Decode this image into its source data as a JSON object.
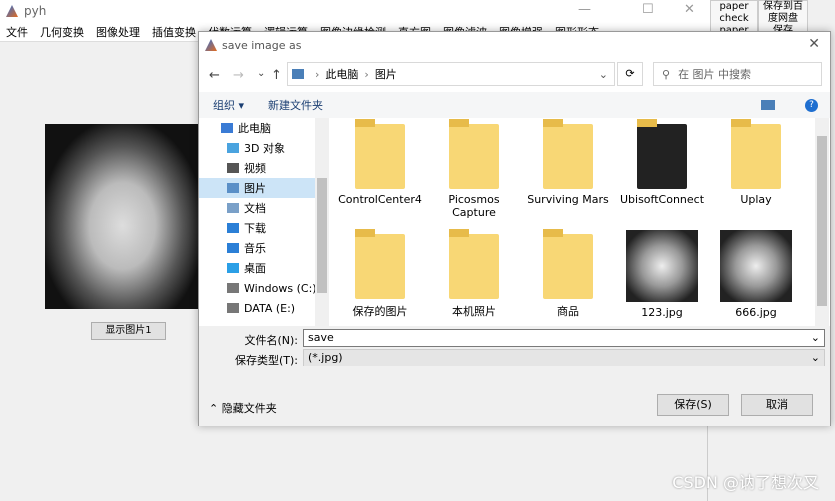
{
  "window": {
    "title": "pyh",
    "minimize": "—",
    "maximize": "☐",
    "close": "✕"
  },
  "menu": [
    "文件",
    "几何变换",
    "图像处理",
    "插值变换",
    "代数运算",
    "逻辑运算",
    "图像边缘检测",
    "直方图",
    "图像滤波",
    "图像增强",
    "图形形态"
  ],
  "right_panel": [
    {
      "label": "paper check"
    },
    {
      "label": "保存到百度网盘"
    }
  ],
  "right_panel_row2": [
    "paper",
    "保存"
  ],
  "main": {
    "show_button": "显示图片1"
  },
  "dialog": {
    "title": "save image as",
    "close": "✕",
    "nav": {
      "back": "←",
      "forward": "→",
      "recent": "⌄",
      "up": "↑"
    },
    "breadcrumb": [
      "此电脑",
      "图片"
    ],
    "search_placeholder": "在 图片 中搜索",
    "toolbar": {
      "organize": "组织 ▾",
      "new_folder": "新建文件夹"
    },
    "sidebar": [
      {
        "label": "此电脑",
        "color": "#3a7bd5"
      },
      {
        "label": "3D 对象",
        "color": "#4aa3df"
      },
      {
        "label": "视频",
        "color": "#555"
      },
      {
        "label": "图片",
        "color": "#5a8fc7",
        "selected": true
      },
      {
        "label": "文档",
        "color": "#7aa0c8"
      },
      {
        "label": "下载",
        "color": "#2b7fd6"
      },
      {
        "label": "音乐",
        "color": "#2b7fd6"
      },
      {
        "label": "桌面",
        "color": "#2b9fe6"
      },
      {
        "label": "Windows (C:)",
        "color": "#777"
      },
      {
        "label": "DATA (E:)",
        "color": "#777"
      }
    ],
    "items": [
      {
        "name": "ControlCenter4",
        "kind": "folder"
      },
      {
        "name": "Picosmos Capture",
        "kind": "folder"
      },
      {
        "name": "Surviving Mars",
        "kind": "folder"
      },
      {
        "name": "UbisoftConnect",
        "kind": "folder-dark"
      },
      {
        "name": "Uplay",
        "kind": "folder"
      },
      {
        "name": "保存的图片",
        "kind": "folder-img"
      },
      {
        "name": "本机照片",
        "kind": "folder"
      },
      {
        "name": "商品",
        "kind": "folder-doc"
      },
      {
        "name": "123.jpg",
        "kind": "image"
      },
      {
        "name": "666.jpg",
        "kind": "image"
      }
    ],
    "filename_label": "文件名(N):",
    "filename_value": "save",
    "filetype_label": "保存类型(T):",
    "filetype_value": "(*.jpg)",
    "hide_folders": "隐藏文件夹",
    "save": "保存(S)",
    "cancel": "取消"
  },
  "watermark": "CSDN @讷了想次叉"
}
